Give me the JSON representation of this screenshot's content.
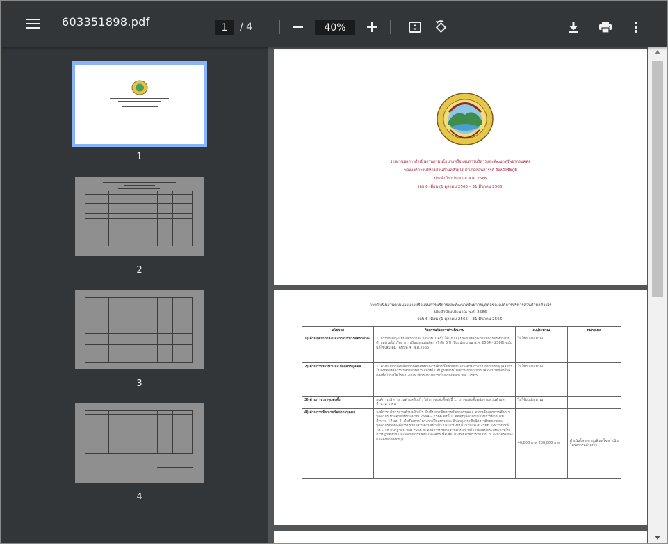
{
  "toolbar": {
    "file_name": "603351898.pdf",
    "current_page": "1",
    "page_total": "/ 4",
    "zoom": "40%"
  },
  "icons": {
    "menu": "hamburger-menu-icon",
    "zoom_out": "minus-icon",
    "zoom_in": "plus-icon",
    "fit": "fit-to-page-icon",
    "rotate": "rotate-icon",
    "download": "download-icon",
    "print": "print-icon",
    "more": "more-vertical-icon"
  },
  "colors": {
    "toolbar_bg": "#323639",
    "viewer_bg": "#525659",
    "selected_thumb": "#8ab4f8",
    "doc_red": "#a2263b"
  },
  "thumbnails": [
    {
      "label": "1"
    },
    {
      "label": "2"
    },
    {
      "label": "3"
    },
    {
      "label": "4"
    }
  ],
  "page1": {
    "lines": [
      "รายงานผลการดำเนินงานตามนโยบายหรือแผนการบริหารและพัฒนาทรัพยากรบุคคล",
      "ขององค์การบริหารส่วนตำบลห้วยไร่ อำเภอคอนสวรรค์ จังหวัดชัยภูมิ",
      "ประจำปีงบประมาณ พ.ศ. 2566",
      "รอบ 6 เดือน (1 ตุลาคม 2565 – 31 มีนาคม 2566)"
    ]
  },
  "page2": {
    "heading": [
      "การดำเนินงานตามนโยบายหรือแผนการบริหารและพัฒนาทรัพยากรบุคคลขององค์การบริหารส่วนตำบลห้วยไร่",
      "ประจำปีงบประมาณ พ.ศ. 2566",
      "รอบ 6 เดือน (1 ตุลาคม 2565 – 31 มีนาคม 2566)"
    ],
    "columns": [
      "นโยบาย",
      "กิจกรรม/ผลการดำเนินงาน",
      "งบประมาณ",
      "หมายเหตุ"
    ],
    "rows": [
      {
        "policy": "1) ด้านอัตรากำลังและการบริหารอัตรากำลัง",
        "activity": "1. การปรับปรุงแผนอัตรากำลัง จำนวน 1 ครั้ง ได้แก่ (1) ประกาศคณะกรรมการบริหารส่วนตำบลห้วยไร่ เรื่อง การปรับปรุงแผนอัตรากำลัง 3 ปี (ปีงบประมาณ พ.ศ. 2564 - 2566) ฉบับแก้ไขเพิ่มเติม (ฉบับที่ 4) พ.ศ.2565",
        "budget": "ไม่ใช้งบประมาณ",
        "note": ""
      },
      {
        "policy": "2) ด้านการสรรหาและเลือกสรรบุคคล",
        "activity": "1. ดำเนินการคัดเลือกกรณีพิเศษพนักงานจ้างเป็นพนักงานจ้างตามภารกิจ กรณีบรรจุบุคลากรในสังกัดองค์การบริหารส่วนตำบลห้วยไร่ ที่ปฏิบัติงานในสถานการณ์การแพร่ระบาดของโรคติดเชื้อไวรัสโคโรนา 2019 เข้ารับราชการเป็นกรณีพิเศษ พ.ศ. 2565",
        "budget": "ไม่ใช้งบประมาณ",
        "note": ""
      },
      {
        "policy": "3) ด้านการบรรจุแต่งตั้ง",
        "activity": "องค์การบริหารส่วนตำบลห้วยไร่ ได้บรรจุแต่งตั้งดังนี้ 1. บรรจุแต่งตั้งพนักงานส่วนตำบล จำนวน 1 คน",
        "budget": "ไม่ใช้งบประมาณ",
        "note": ""
      },
      {
        "policy": "4) ด้านการพัฒนาทรัพยากรบุคคล",
        "activity": "องค์การบริหารส่วนตำบลห้วยไร่ ดำเนินการพัฒนาทรัพยากรบุคคล ตามหลักสูตรการพัฒนาบุคลากร ประจำปีงบประมาณ 2564 – 2566 ดังนี้ 1. จัดส่งบุคลากรเข้ารับการฝึกอบรม จำนวน 12 คน 2. ดำเนินการโครงการฝึกอบรมและศึกษาดูงานเพื่อพัฒนาศักยภาพของบุคลากรขององค์การบริหารส่วนตำบลห้วยไร่ ประจำปีงบประมาณ พ.ศ.2566 ระหว่างวันที่ 16 – 18 กรกฎาคม พ.ศ.2566 ณ องค์การบริหารส่วนตำบลห้วยไร่ เพื่อเพิ่มประสิทธิภาพในการปฏิบัติงาน และจัดกิจกรรมพัฒนาองค์กรเพื่อเพิ่มประสิทธิภาพการทำงาน ณ จังหวัดระยอง และจังหวัดจันทบุรี",
        "budget": "40,000 บาท 200,000 บาท",
        "note": "ดำเนินโครงการแล้วเสร็จ ดำเนินโครงการแล้วเสร็จ"
      }
    ]
  }
}
